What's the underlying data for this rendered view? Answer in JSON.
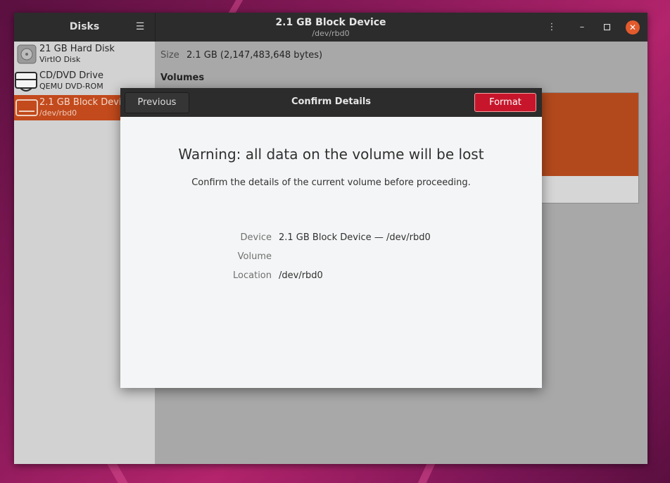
{
  "window": {
    "sidebar_title": "Disks",
    "title": "2.1 GB Block Device",
    "subtitle": "/dev/rbd0",
    "icons": {
      "menu": "hamburger-menu-icon",
      "kebab": "kebab-menu-icon",
      "minimize": "minimize-icon",
      "maximize": "maximize-icon",
      "close": "close-icon"
    }
  },
  "sidebar": {
    "items": [
      {
        "name": "21 GB Hard Disk",
        "sub": "VirtIO Disk",
        "icon": "hard-disk-icon"
      },
      {
        "name": "CD/DVD Drive",
        "sub": "QEMU DVD-ROM",
        "icon": "optical-drive-icon"
      },
      {
        "name": "2.1 GB Block Device",
        "sub": "/dev/rbd0",
        "icon": "block-device-icon",
        "selected": true
      }
    ]
  },
  "main": {
    "size_label": "Size",
    "size_value": "2.1 GB (2,147,483,648 bytes)",
    "volumes_label": "Volumes"
  },
  "dialog": {
    "previous_label": "Previous",
    "title": "Confirm Details",
    "format_label": "Format",
    "heading": "Warning: all data on the volume will be lost",
    "description": "Confirm the details of the current volume before proceeding.",
    "details": [
      {
        "label": "Device",
        "value": "2.1 GB Block Device — /dev/rbd0"
      },
      {
        "label": "Volume",
        "value": ""
      },
      {
        "label": "Location",
        "value": "/dev/rbd0"
      }
    ]
  },
  "colors": {
    "accent": "#c24a1c",
    "destructive": "#c7162b",
    "headerbar": "#2c2c2c"
  }
}
